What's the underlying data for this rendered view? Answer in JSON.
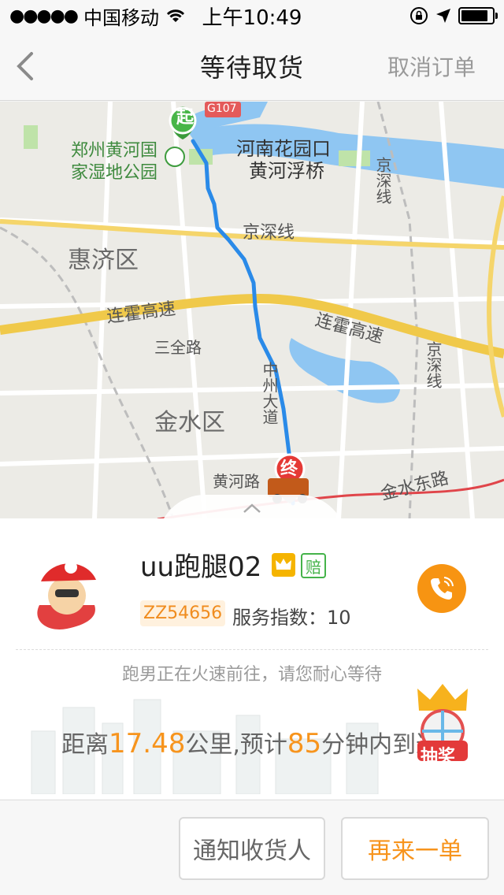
{
  "status_bar": {
    "signal": "●●●●●",
    "carrier": "中国移动",
    "time": "上午10:49"
  },
  "nav": {
    "title": "等待取货",
    "cancel_label": "取消订单"
  },
  "map": {
    "labels": {
      "park": "郑州黄河国家湿地公园",
      "park_line1": "郑州黄河国",
      "park_line2": "家湿地公园",
      "bridge_line1": "河南花园口",
      "bridge_line2": "黄河浮桥",
      "g107": "G107",
      "jingshen_1": "京深线",
      "jingshen_2": "京深线",
      "jingshen_3": "京深线",
      "huiji": "惠济区",
      "lianhuo_1": "连霍高速",
      "lianhuo_2": "连霍高速",
      "sanquan": "三全路",
      "jinshui": "金水区",
      "zhongzhou": "中州大道",
      "huanghe_rd": "黄河路",
      "jinshui_east": "金水东路"
    },
    "start_marker": "起",
    "end_marker": "终"
  },
  "courier": {
    "name": "uu跑腿02",
    "pei_badge": "赔",
    "id": "ZZ54656",
    "service_index": "服务指数：10",
    "waiting_message": "跑男正在火速前往，请您耐心等待",
    "distance_prefix": "距离",
    "distance_km": "17.48",
    "distance_unit": "公里,预计",
    "eta_minutes": "85",
    "eta_suffix": "分钟内到达"
  },
  "lottery_label": "抽奖",
  "footer": {
    "notify_label": "通知收货人",
    "reorder_label": "再来一单"
  },
  "colors": {
    "accent": "#f7941d",
    "route": "#2a8ae8",
    "highway": "#f0c94a"
  }
}
